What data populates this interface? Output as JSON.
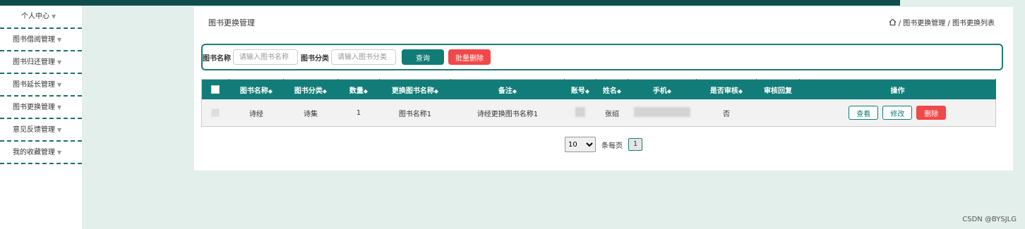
{
  "sidebar": {
    "items": [
      {
        "label": "个人中心"
      },
      {
        "label": "图书借阅管理"
      },
      {
        "label": "图书归还管理"
      },
      {
        "label": "图书延长管理"
      },
      {
        "label": "图书更换管理"
      },
      {
        "label": "意见反馈管理"
      },
      {
        "label": "我的收藏管理"
      }
    ]
  },
  "header": {
    "title": "图书更换管理",
    "breadcrumb": " / 图书更换管理 / 图书更换列表"
  },
  "search": {
    "name_label": "图书名称",
    "name_placeholder": "请输入图书名称",
    "category_label": "图书分类",
    "category_placeholder": "请输入图书分类",
    "query_label": "查询",
    "batch_delete_label": "批量删除"
  },
  "table": {
    "columns": [
      "图书名称",
      "图书分类",
      "数量",
      "更换图书名称",
      "备注",
      "账号",
      "姓名",
      "手机",
      "是否审核",
      "审核回复",
      "操作"
    ],
    "sort_icon": "◆",
    "rows": [
      {
        "book_name": "诗经",
        "category": "诗集",
        "quantity": "1",
        "replace_name": "图书名称1",
        "remark": "诗经更换图书名称1",
        "name": "张绍",
        "approved": "否",
        "reply": ""
      }
    ],
    "actions": {
      "view": "查看",
      "edit": "修改",
      "delete": "删除"
    }
  },
  "pagination": {
    "page_size": "10",
    "per_page_label": "条每页",
    "current_page": "1"
  },
  "watermark": "CSDN @BYSJLG",
  "colors": {
    "accent": "#127d78",
    "danger": "#f04949",
    "topbar": "#0e4d4b"
  }
}
